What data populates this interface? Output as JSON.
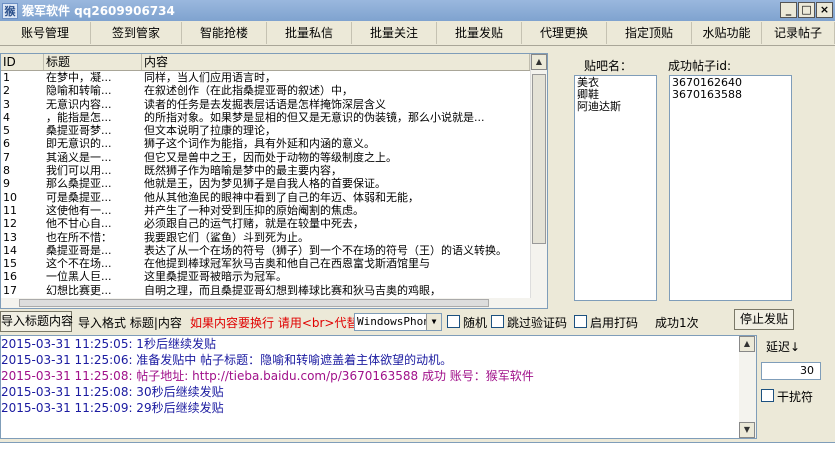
{
  "window": {
    "title": "猴军软件 qq2609906734",
    "minimize": "_",
    "maximize": "□",
    "close": "×"
  },
  "toolbar": [
    {
      "label": "账号管理",
      "w": 91
    },
    {
      "label": "签到管家",
      "w": 91
    },
    {
      "label": "智能抢楼",
      "w": 85
    },
    {
      "label": "批量私信",
      "w": 85
    },
    {
      "label": "批量关注",
      "w": 85
    },
    {
      "label": "批量发贴",
      "w": 85
    },
    {
      "label": "代理更换",
      "w": 85
    },
    {
      "label": "指定顶贴",
      "w": 85
    },
    {
      "label": "水贴功能",
      "w": 70
    },
    {
      "label": "记录帖子",
      "w": 73
    }
  ],
  "table": {
    "headers": [
      "ID",
      "标题",
      "内容"
    ],
    "rows": [
      [
        "1",
        "在梦中，凝...",
        "同样，当人们应用语言时，"
      ],
      [
        "2",
        "隐喻和转喻...",
        "在叙述创作（在此指桑提亚哥的叙述）中，"
      ],
      [
        "3",
        "无意识内容...",
        "读者的任务是去发掘表层话语是怎样掩饰深层含义"
      ],
      [
        "4",
        "，能指是怎...",
        "的所指对象。如果梦是显相的但又是无意识的伪装镜，那么小说就是..."
      ],
      [
        "5",
        "桑提亚哥梦...",
        "但文本说明了拉康的理论，"
      ],
      [
        "6",
        "即无意识的...",
        "狮子这个词作为能指，具有外延和内涵的意义。"
      ],
      [
        "7",
        "其涵义是一...",
        "但它又是兽中之王，因而处于动物的等级制度之上。"
      ],
      [
        "8",
        "我们可以用...",
        "既然狮子作为暗喻是梦中的最主要内容，"
      ],
      [
        "9",
        "那么桑提亚...",
        "他就是王，因为梦见狮子是自我人格的首要保证。"
      ],
      [
        "10",
        "可是桑提亚...",
        "他从其他渔民的眼神中看到了自己的年迈、体弱和无能，"
      ],
      [
        "11",
        "这使他有一...",
        "并产生了一种对受到压抑的原始阉割的焦虑。"
      ],
      [
        "12",
        "他不甘心自...",
        "必须跟自己的运气打赌，就是在较量中死去，"
      ],
      [
        "13",
        "也在所不惜：",
        "我要跟它们（鲨鱼）斗到死为止。"
      ],
      [
        "14",
        "桑提亚哥是...",
        "表达了从一个在场的符号（狮子）到一个不在场的符号（王）的语义转换。"
      ],
      [
        "15",
        "这个不在场...",
        "在他提到棒球冠军狄马吉奥和他自己在西恩富戈斯酒馆里与"
      ],
      [
        "16",
        "一位黑人巨...",
        "这里桑提亚哥被暗示为冠军。"
      ],
      [
        "17",
        "幻想比赛更...",
        "自明之理，而且桑提亚哥幻想到棒球比赛和狄马吉奥的鸡眼，"
      ]
    ]
  },
  "bars_label": "贴吧名：",
  "bars": [
    "美衣",
    "卿鞋",
    "阿迪达斯"
  ],
  "success_label": "成功帖子id:",
  "success_ids": [
    "3670162640",
    "3670163588"
  ],
  "controls": {
    "import_title": "导入标题内容",
    "import_format": "导入格式 标题|内容",
    "newline_hint": "如果内容要换行 请用<br>代替",
    "device": "WindowsPhon",
    "random": "随机",
    "skip_captcha": "跳过验证码",
    "enable_code": "启用打码",
    "success_count": "成功1次",
    "stop_button": "停止发贴"
  },
  "side": {
    "delay_label": "延迟↓",
    "delay_value": "30",
    "interfere": "干扰符"
  },
  "log": [
    {
      "text": "2015-03-31 11:25:05: 1秒后继续发贴",
      "color": "#1a1aa0"
    },
    {
      "text": "2015-03-31 11:25:06: 准备发贴中    帖子标题：隐喻和转喻遮盖着主体欲望的动机。",
      "color": "#1a1aa0"
    },
    {
      "text": "2015-03-31 11:25:08: 帖子地址: http://tieba.baidu.com/p/3670163588  成功  账号：猴军软件",
      "color": "#a0108a"
    },
    {
      "text": "2015-03-31 11:25:08: 30秒后继续发贴",
      "color": "#1a1aa0"
    },
    {
      "text": "2015-03-31 11:25:09: 29秒后继续发贴",
      "color": "#1a1aa0"
    }
  ]
}
